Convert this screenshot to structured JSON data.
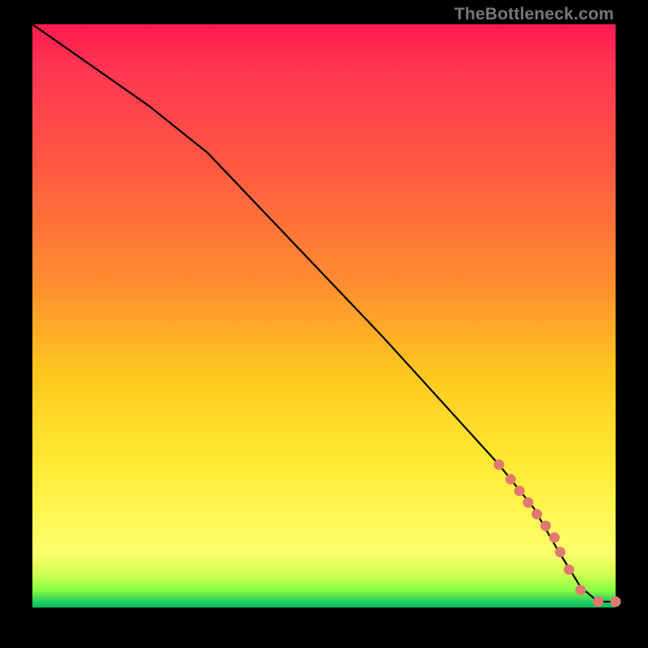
{
  "watermark": "TheBottleneck.com",
  "colors": {
    "curve_stroke": "#000000",
    "marker_fill": "#e07a6f",
    "marker_stroke": "#e07a6f",
    "background": "#000000"
  },
  "chart_data": {
    "type": "line",
    "title": "",
    "xlabel": "",
    "ylabel": "",
    "xlim": [
      0,
      100
    ],
    "ylim": [
      0,
      100
    ],
    "series": [
      {
        "name": "curve",
        "x": [
          0,
          10,
          20,
          30,
          40,
          50,
          60,
          70,
          80,
          86,
          90,
          94,
          97,
          100
        ],
        "y": [
          100,
          93,
          86,
          78,
          67.5,
          57,
          46.5,
          35.5,
          24.5,
          17,
          10,
          3.5,
          1.0,
          1.0
        ]
      }
    ],
    "markers": {
      "name": "highlight-segment",
      "x": [
        80,
        82,
        83.5,
        85,
        86.5,
        88,
        89.5,
        90.5,
        92,
        94,
        97,
        100
      ],
      "y": [
        24.5,
        22,
        20,
        18,
        16,
        14,
        12,
        9.5,
        6.5,
        3.0,
        1.0,
        1.0
      ]
    }
  }
}
